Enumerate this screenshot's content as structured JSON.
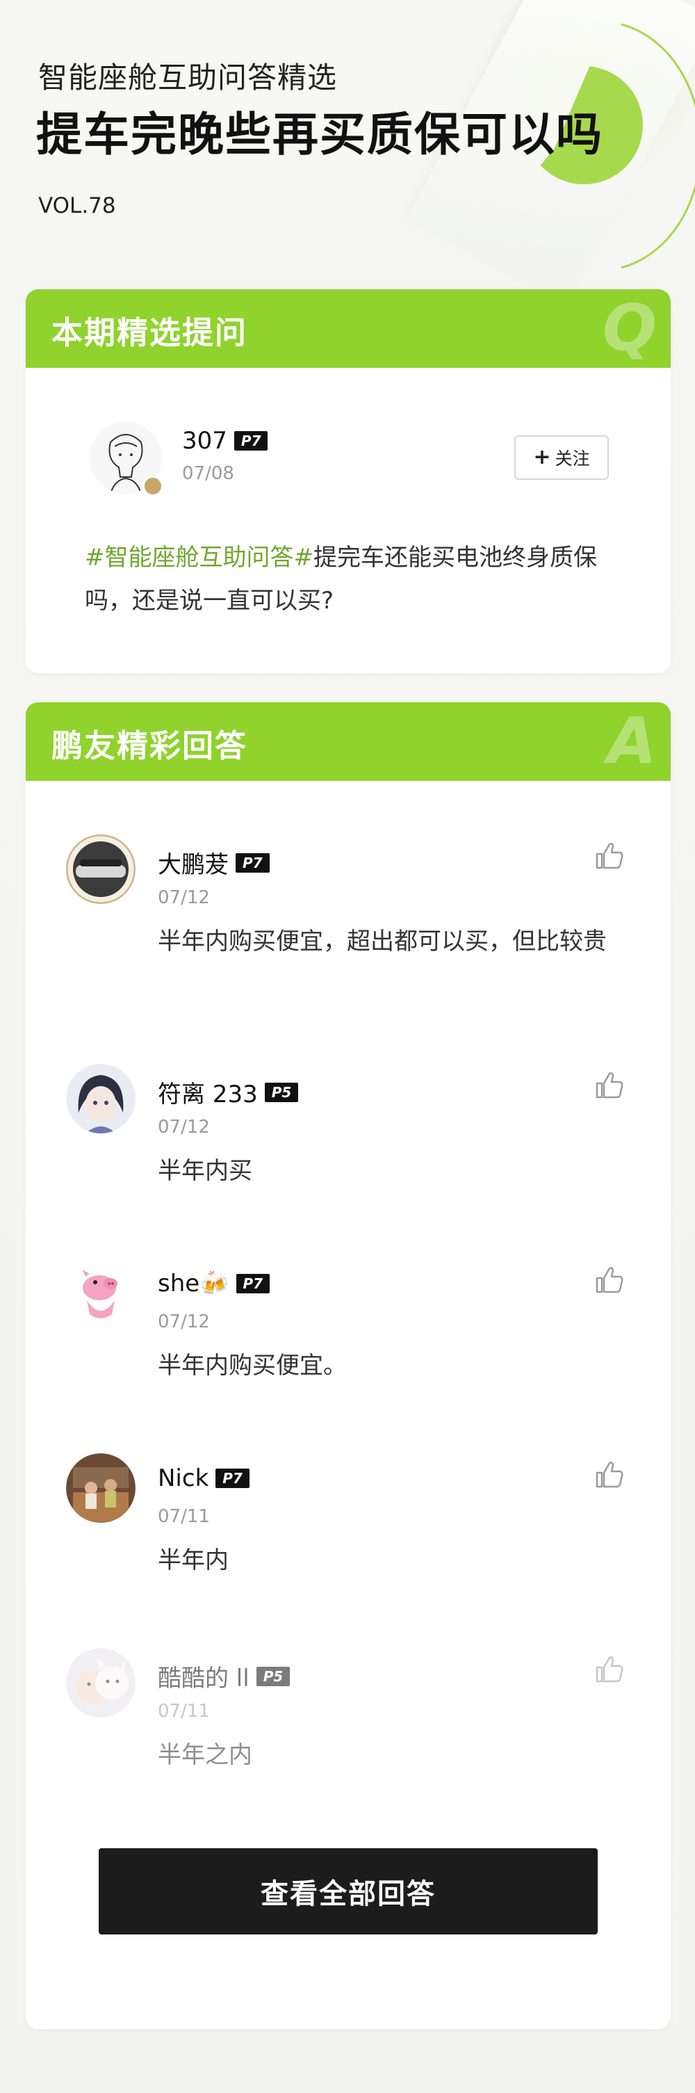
{
  "header": {
    "subtitle": "智能座舱互助问答精选",
    "title": "提车完晚些再买质保可以吗",
    "vol": "VOL.78"
  },
  "question_card": {
    "title": "本期精选提问",
    "corner_letter": "Q",
    "user": {
      "name": "307",
      "level": "P7",
      "date": "07/08"
    },
    "follow_label": "关注",
    "hashtag": "#智能座舱互助问答#",
    "question": "提完车还能买电池终身质保吗，还是说一直可以买?"
  },
  "answer_card": {
    "title": "鹏友精彩回答",
    "corner_letter": "A",
    "answers": [
      {
        "name": "大鹏茇",
        "level": "P7",
        "date": "07/12",
        "text": "半年内购买便宜，超出都可以买，但比较贵",
        "avatar": "car-avatar"
      },
      {
        "name": "符离 233",
        "level": "P5",
        "date": "07/12",
        "text": "半年内买",
        "avatar": "anime-girl-avatar"
      },
      {
        "name": "she🍻",
        "level": "P7",
        "date": "07/12",
        "text": "半年内购买便宜。",
        "avatar": "pink-pig-avatar"
      },
      {
        "name": "Nick",
        "level": "P7",
        "date": "07/11",
        "text": "半年内",
        "avatar": "photo-avatar"
      },
      {
        "name": "酷酷的 ll",
        "level": "P5",
        "date": "07/11",
        "text": "半年之内",
        "avatar": "dog-avatar"
      }
    ],
    "view_all_label": "查看全部回答"
  },
  "colors": {
    "accent_green": "#8fd32c",
    "hashtag_green": "#6ea82c",
    "button_dark": "#1c1c1c"
  }
}
